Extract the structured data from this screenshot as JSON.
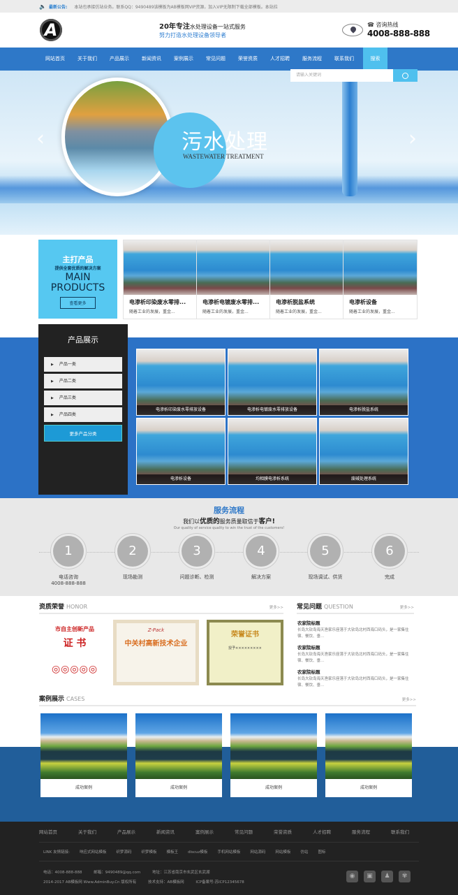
{
  "topbar": {
    "label": "最新公告:",
    "text": "本站也承接仿站业务。联系QQ：9490489该模板为AB模板网VIP资源，加入VIP无限制下载全部模板。本站拉"
  },
  "header": {
    "logo_letter": "A",
    "slogan_bold": "20年专注",
    "slogan_rest": "水处理设备一站式服务",
    "slogan_line2": "努力打造水处理设备领导者",
    "hotline_label": "咨询热线",
    "hotline_number": "4008-888-888"
  },
  "nav": {
    "items": [
      "网站首页",
      "关于我们",
      "产品展示",
      "新闻资讯",
      "案例展示",
      "常见问题",
      "荣誉资质",
      "人才招聘",
      "服务流程",
      "联系我们"
    ],
    "search_label": "搜索",
    "search_placeholder": "请输入关键词"
  },
  "banner": {
    "title_highlight": "污水",
    "title_rest": "处理",
    "subtitle": "WASTEWATER TREATMENT",
    "prev": "‹",
    "next": "›"
  },
  "main_products": {
    "title": "主打产品",
    "subtitle": "提供全套优质的解决方案",
    "en_line1": "MAIN",
    "en_line2": "PRODUCTS",
    "more_label": "查看更多",
    "items": [
      {
        "title": "电渗析印染废水零排...",
        "desc": "随着工业的发展，重金..."
      },
      {
        "title": "电渗析电镀废水零排...",
        "desc": "随着工业的发展，重金..."
      },
      {
        "title": "电渗析脱盐系统",
        "desc": "随着工业的发展，重金..."
      },
      {
        "title": "电渗析设备",
        "desc": "随着工业的发展，重金..."
      }
    ]
  },
  "product_show": {
    "title": "产品展示",
    "categories": [
      "产品一类",
      "产品二类",
      "产品三类",
      "产品四类"
    ],
    "more_label": "更多产品分类",
    "items": [
      "电渗析印染废水零排放设备",
      "电渗析电镀废水零排放设备",
      "电渗析脱盐系统",
      "电渗析设备",
      "均相膜电渗析系统",
      "废碱处理系统"
    ]
  },
  "process": {
    "title": "服务流程",
    "line_a": "我们以",
    "line_b": "优质的",
    "line_c": "服务质量取信于",
    "line_d": "客户!",
    "en": "Our quality of service quality to win the trust of the customers!",
    "steps": [
      {
        "num": "1",
        "label": "电话咨询",
        "sub": "4008-888-888"
      },
      {
        "num": "2",
        "label": "现场勘测",
        "sub": ""
      },
      {
        "num": "3",
        "label": "问题诊断、检测",
        "sub": ""
      },
      {
        "num": "4",
        "label": "解决方案",
        "sub": ""
      },
      {
        "num": "5",
        "label": "现场调试、供货",
        "sub": ""
      },
      {
        "num": "6",
        "label": "完成",
        "sub": ""
      }
    ]
  },
  "honor": {
    "cn": "资质荣誉",
    "en": "HONOR",
    "more": "更多>>",
    "certs": [
      {
        "l1": "市自主创新产品",
        "l2": "证 书"
      },
      {
        "l1": "Z-Pack",
        "l2": "中关村高新技术企业"
      },
      {
        "l1": "荣誉证书",
        "l2": "授予×××××××××"
      }
    ]
  },
  "faq": {
    "cn": "常见问题",
    "en": "QUESTION",
    "more": "更多>>",
    "items": [
      {
        "q": "农家院标题",
        "a": "长岛大钦岛海天渔家乐座落于大钦岛北村西海口码头，是一家集住宿、餐饮、垂..."
      },
      {
        "q": "农家院标题",
        "a": "长岛大钦岛海天渔家乐座落于大钦岛北村西海口码头，是一家集住宿、餐饮、垂..."
      },
      {
        "q": "农家院标题",
        "a": "长岛大钦岛海天渔家乐座落于大钦岛北村西海口码头，是一家集住宿、餐饮、垂..."
      }
    ]
  },
  "cases": {
    "cn": "案例展示",
    "en": "CASES",
    "more": "更多>>",
    "items": [
      "成功案例",
      "成功案例",
      "成功案例",
      "成功案例"
    ]
  },
  "footer": {
    "nav": [
      "网站首页",
      "关于我们",
      "产品展示",
      "新闻资讯",
      "案例展示",
      "常见问题",
      "荣誉资质",
      "人才招聘",
      "服务流程",
      "联系我们"
    ],
    "links_label": "LINK 友情链接:",
    "links": [
      "响应式网站模板",
      "织梦源码",
      "织梦模板",
      "模板王",
      "discuz模板",
      "手机网站模板",
      "网站源码",
      "网站模板",
      "仿站",
      "图标"
    ],
    "phone": "电话：4008-888-888",
    "email": "邮箱：9490489@qq.com",
    "address": "地址：江苏省南京市玄武区玄武湖",
    "copyright": "2014-2017 AB模板网 Www.AdminBuy.Cn 版权所有",
    "tech": "技术支持：AB模板网",
    "icp": "ICP备案号:苏ICP12345678",
    "social_icons": [
      "weibo-icon",
      "wechat-icon",
      "qq-icon",
      "paw-icon"
    ]
  }
}
